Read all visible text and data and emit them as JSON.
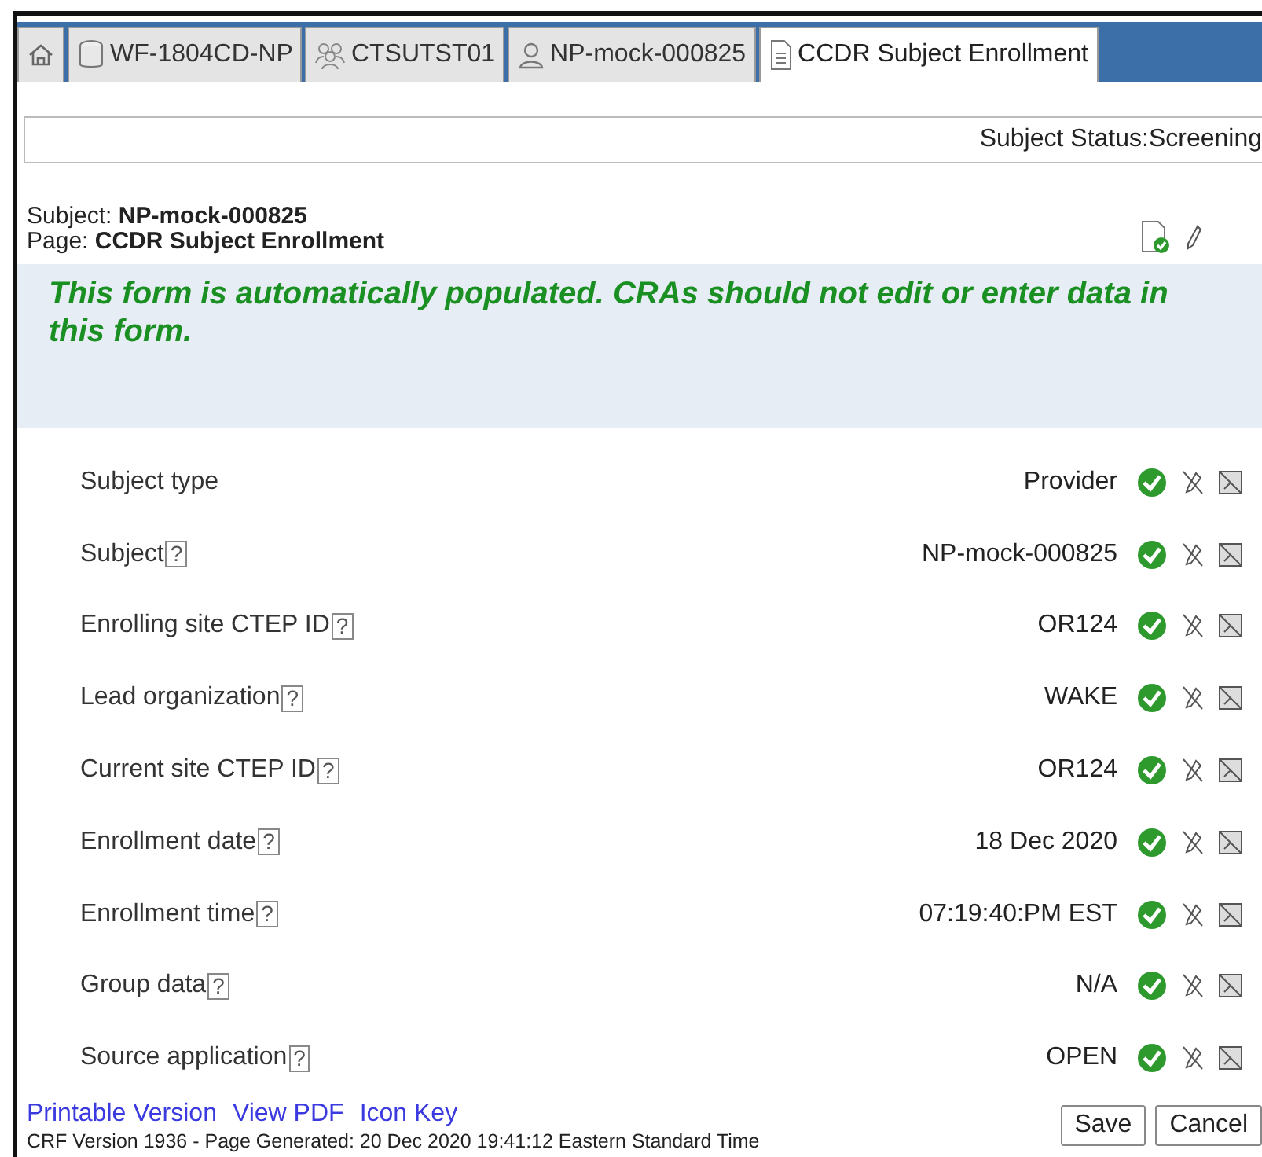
{
  "tabs": [
    {
      "kind": "home",
      "selected": false
    },
    {
      "kind": "study",
      "label": "WF-1804CD-NP",
      "selected": false
    },
    {
      "kind": "group",
      "label": "CTSUTST01",
      "selected": false
    },
    {
      "kind": "person",
      "label": "NP-mock-000825",
      "selected": false
    },
    {
      "kind": "page",
      "label": "CCDR Subject Enrollment",
      "selected": true
    }
  ],
  "status": "Subject Status:Screening",
  "header": {
    "subject_label": "Subject:",
    "subject": "NP-mock-000825",
    "page_label": "Page:",
    "page": "CCDR Subject Enrollment"
  },
  "notice": "This form is automatically populated. CRAs should not edit or enter data in this form.",
  "fields": [
    {
      "label": "Subject type",
      "value": "Provider"
    },
    {
      "label": "Subject",
      "help": "?",
      "value": "NP-mock-000825"
    },
    {
      "label": "Enrolling site CTEP ID",
      "help": "?",
      "value": "OR124"
    },
    {
      "label": "Lead organization",
      "help": "?",
      "value": "WAKE"
    },
    {
      "label": "Current site CTEP ID",
      "help": "?",
      "value": "OR124"
    },
    {
      "label": "Enrollment date",
      "help": "?",
      "value": "18 Dec 2020"
    },
    {
      "label": "Enrollment time",
      "help": "?",
      "value": "07:19:40:PM EST"
    },
    {
      "label": "Group data",
      "help": "?",
      "value": "N/A"
    },
    {
      "label": "Source application",
      "help": "?",
      "value": "OPEN"
    }
  ],
  "links": [
    "Printable Version",
    "View PDF",
    "Icon Key"
  ],
  "footer": "CRF Version 1936 - Page Generated: 20 Dec 2020 19:41:12 Eastern Standard Time",
  "buttons": [
    "Save",
    "Cancel"
  ]
}
